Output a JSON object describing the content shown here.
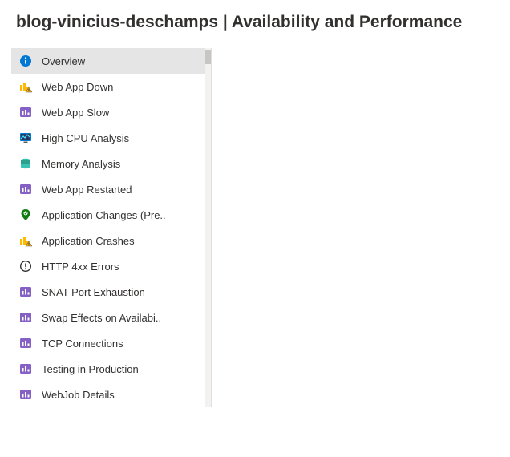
{
  "header": {
    "title": "blog-vinicius-deschamps | Availability and Performance"
  },
  "sidebar": {
    "items": [
      {
        "label": "Overview",
        "icon": "info-icon",
        "selected": true
      },
      {
        "label": "Web App Down",
        "icon": "bars-warning-icon",
        "selected": false
      },
      {
        "label": "Web App Slow",
        "icon": "purple-chart-icon",
        "selected": false
      },
      {
        "label": "High CPU Analysis",
        "icon": "monitor-icon",
        "selected": false
      },
      {
        "label": "Memory Analysis",
        "icon": "database-icon",
        "selected": false
      },
      {
        "label": "Web App Restarted",
        "icon": "purple-chart-icon",
        "selected": false
      },
      {
        "label": "Application Changes (Pre..",
        "icon": "location-check-icon",
        "selected": false
      },
      {
        "label": "Application Crashes",
        "icon": "bars-warning-icon",
        "selected": false
      },
      {
        "label": "HTTP 4xx Errors",
        "icon": "exclamation-circle-icon",
        "selected": false
      },
      {
        "label": "SNAT Port Exhaustion",
        "icon": "purple-chart-icon",
        "selected": false
      },
      {
        "label": "Swap Effects on Availabi..",
        "icon": "purple-chart-icon",
        "selected": false
      },
      {
        "label": "TCP Connections",
        "icon": "purple-chart-icon",
        "selected": false
      },
      {
        "label": "Testing in Production",
        "icon": "purple-chart-icon",
        "selected": false
      },
      {
        "label": "WebJob Details",
        "icon": "purple-chart-icon",
        "selected": false
      }
    ]
  }
}
